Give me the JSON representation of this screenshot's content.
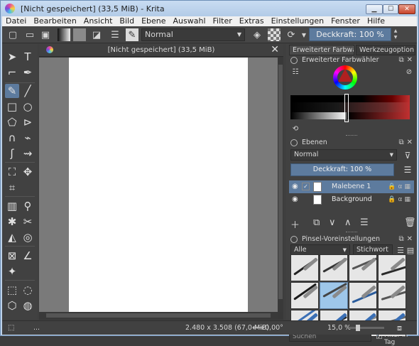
{
  "window": {
    "title": "[Nicht gespeichert]  (33,5 MiB)  - Krita",
    "minimize": "▁",
    "maximize": "☐",
    "close": "✕"
  },
  "menu": [
    "Datei",
    "Bearbeiten",
    "Ansicht",
    "Bild",
    "Ebene",
    "Auswahl",
    "Filter",
    "Extras",
    "Einstellungen",
    "Fenster",
    "Hilfe"
  ],
  "toolbar": {
    "blend_mode": "Normal",
    "opacity": "Deckkraft: 100 %"
  },
  "document": {
    "tab_title": "[Nicht gespeichert]  (33,5 MiB)",
    "tab_close": "✕"
  },
  "dock": {
    "tabs": [
      "Erweiterter Farbwäh...",
      "Werkzeugoption..."
    ],
    "color_panel_title": "Erweiterter Farbwähler",
    "layers_title": "Ebenen",
    "layer_blend_mode": "Normal",
    "layer_opacity": "Deckkraft:  100 %",
    "layers": [
      {
        "name": "Malebene 1",
        "selected": true
      },
      {
        "name": "Background",
        "selected": false
      }
    ],
    "brushes_title": "Pinsel-Voreinstellungen",
    "brush_filter": "Alle",
    "brush_tag": "Stichwort",
    "search_placeholder": "Suchen",
    "filter_in_tag": "Filter in Tag"
  },
  "status": {
    "dots": "...",
    "size": "2.480 x 3.508 (67,0 MiB)",
    "rotation": "0,00°",
    "zoom": "15,0 %"
  },
  "colors": {
    "accent": "#5d7b9e",
    "panel": "#414141",
    "canvas_bg": "#7a7a7a"
  }
}
